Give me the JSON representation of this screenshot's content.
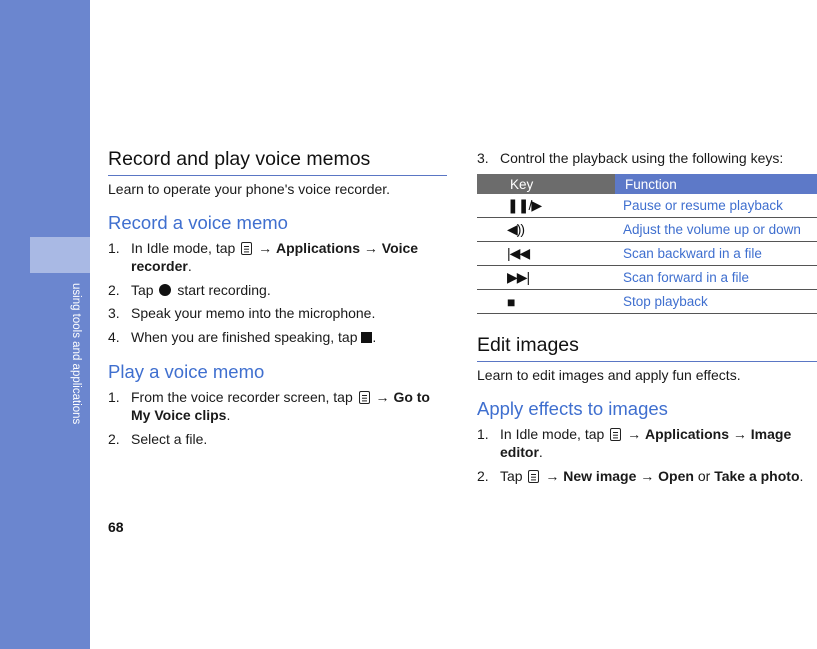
{
  "sidebar": {
    "text": "using tools and applications"
  },
  "page_number": "68",
  "record_section": {
    "title": "Record and play voice memos",
    "intro": "Learn to operate your phone's voice recorder.",
    "record_heading": "Record a voice memo",
    "record_steps": {
      "s1_num": "1.",
      "s1_pre": "In Idle mode, tap",
      "s1_arrow1": "→",
      "s1_apps": "Applications",
      "s1_arrow2": "→",
      "s1_voice": "Voice recorder",
      "s1_end": ".",
      "s2_num": "2.",
      "s2_pre": "Tap",
      "s2_post": "start recording.",
      "s3_num": "3.",
      "s3_text": "Speak your memo into the microphone.",
      "s4_num": "4.",
      "s4_pre": "When you are finished speaking, tap",
      "s4_end": "."
    },
    "play_heading": "Play a voice memo",
    "play_steps": {
      "s1_num": "1.",
      "s1_pre": "From the voice recorder screen, tap",
      "s1_arrow": "→",
      "s1_bold": "Go to My Voice clips",
      "s1_end": ".",
      "s2_num": "2.",
      "s2_text": "Select a file."
    }
  },
  "control": {
    "num": "3.",
    "text": "Control the playback using the following keys:"
  },
  "keys_table": {
    "header_key": "Key",
    "header_function": "Function",
    "rows": [
      {
        "icon": "pause-play-icon",
        "symbol": "❚❚/▶",
        "function": "Pause or resume playback"
      },
      {
        "icon": "volume-icon",
        "symbol": "◀))",
        "function": "Adjust the volume up or down"
      },
      {
        "icon": "scan-backward-icon",
        "symbol": "|◀◀",
        "function": "Scan backward in a file"
      },
      {
        "icon": "scan-forward-icon",
        "symbol": "▶▶|",
        "function": "Scan forward in a file"
      },
      {
        "icon": "stop-icon",
        "symbol": "■",
        "function": "Stop playback"
      }
    ]
  },
  "edit_section": {
    "title": "Edit images",
    "intro": "Learn to edit images and apply fun effects.",
    "apply_heading": "Apply effects to images",
    "steps": {
      "s1_num": "1.",
      "s1_pre": "In Idle mode, tap",
      "s1_arrow1": "→",
      "s1_apps": "Applications",
      "s1_arrow2": "→",
      "s1_bold": "Image editor",
      "s1_end": ".",
      "s2_num": "2.",
      "s2_pre": "Tap",
      "s2_arrow1": "→",
      "s2_new": "New image",
      "s2_arrow2": "→",
      "s2_open": "Open",
      "s2_or": "or",
      "s2_take": "Take a photo",
      "s2_end": "."
    }
  },
  "colors": {
    "sidebar": "#6b86cf",
    "sidebar_tab": "#a9b9e4",
    "heading_blue": "#3f6fcf",
    "table_header": "#5d79c8",
    "table_key_header": "#6c6c6c"
  }
}
